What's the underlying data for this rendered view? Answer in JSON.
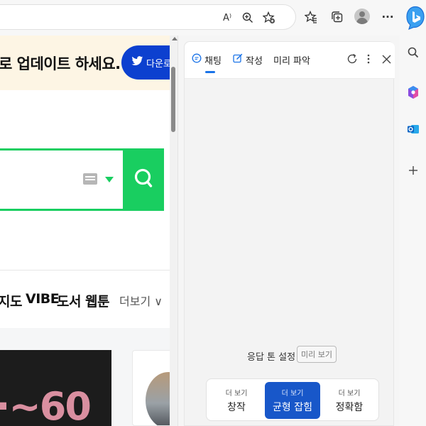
{
  "toolbar": {
    "icons": [
      "read-aloud-icon",
      "zoom-icon",
      "add-favorite-icon",
      "favorites-icon",
      "collections-icon",
      "profile-avatar",
      "more-icon",
      "bing-copilot-icon"
    ],
    "read_aloud_glyph": "A⁾",
    "more_glyph": "···"
  },
  "webpage": {
    "banner": {
      "text": "로 업데이트 하세요.",
      "button_label": "다운로",
      "bg_color": "#fdf5e4",
      "button_color": "#0c40cf"
    },
    "search": {
      "accent_color": "#19ce60"
    },
    "nav": {
      "items": [
        "지도",
        "VIBE",
        "도서",
        "웹툰"
      ],
      "more_label": "더보기",
      "more_chevron": "∨"
    },
    "promo": {
      "text": "·~60"
    }
  },
  "copilot": {
    "tabs": [
      {
        "label": "채팅",
        "icon": "chat-icon",
        "active": true
      },
      {
        "label": "작성",
        "icon": "compose-icon",
        "active": false
      },
      {
        "label": "미리 파악",
        "icon": "",
        "active": false
      }
    ],
    "header_icons": [
      "refresh-icon",
      "more-options-icon",
      "close-icon"
    ],
    "tone": {
      "label": "응답 톤 설정",
      "badge": "미리 보기",
      "options": [
        {
          "small": "더 보기",
          "label": "창작",
          "selected": false
        },
        {
          "small": "더 보기",
          "label": "균형 잡힘",
          "selected": true
        },
        {
          "small": "더 보기",
          "label": "정확함",
          "selected": false
        }
      ],
      "selected_color": "#1857c9"
    }
  },
  "sidebar": {
    "icons": [
      "search-icon",
      "copilot-icon",
      "outlook-icon",
      "add-icon"
    ]
  }
}
